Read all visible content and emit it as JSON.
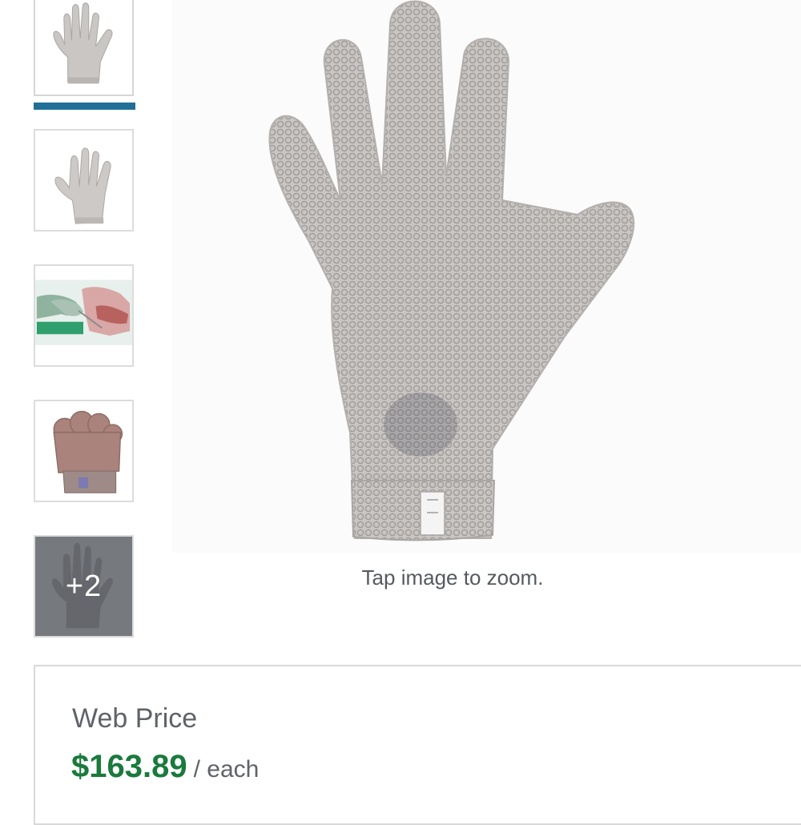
{
  "gallery": {
    "thumbnails": [
      {
        "icon": "glove-palm-icon"
      },
      {
        "icon": "glove-angle-icon"
      },
      {
        "icon": "glove-in-use-photo"
      },
      {
        "icon": "glove-fist-icon"
      },
      {
        "icon": "glove-more-icon",
        "more_label": "+2"
      }
    ],
    "active_color": "#1f6f97"
  },
  "main_image": {
    "icon": "chainmail-glove-image",
    "zoom_hint": "Tap image to zoom."
  },
  "pricing": {
    "title": "Web Price",
    "amount": "$163.89",
    "unit": "/ each",
    "amount_color": "#1a7a3c"
  }
}
